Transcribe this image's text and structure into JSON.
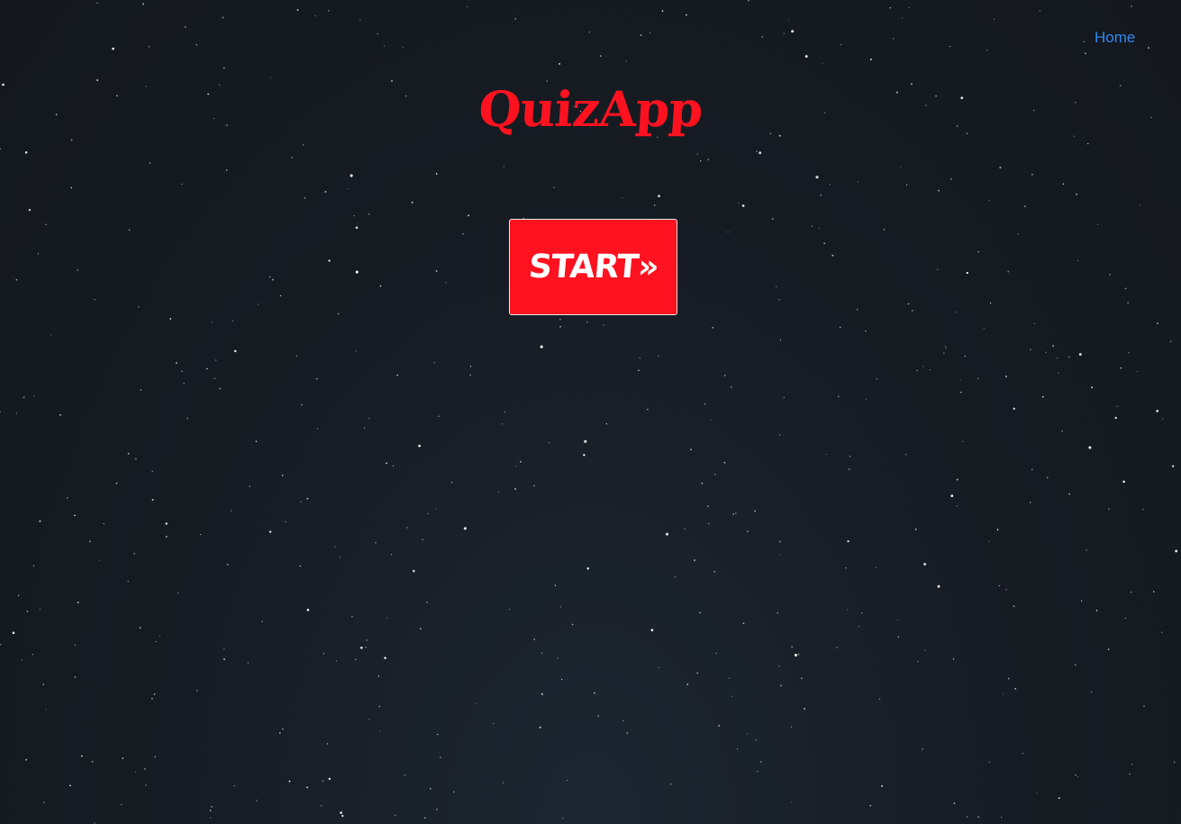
{
  "nav": {
    "home_label": "Home"
  },
  "header": {
    "title": "QuizApp"
  },
  "main": {
    "start_label": "START»"
  },
  "colors": {
    "background": "#161b22",
    "title": "#ff1220",
    "button": "#ff121f",
    "link": "#2f88f0"
  }
}
